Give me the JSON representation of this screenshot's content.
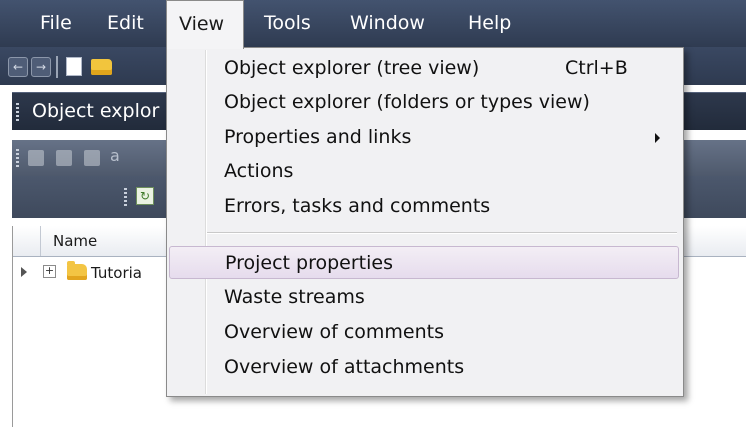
{
  "menubar": {
    "items": [
      {
        "label": "File"
      },
      {
        "label": "Edit"
      },
      {
        "label": "View"
      },
      {
        "label": "Tools"
      },
      {
        "label": "Window"
      },
      {
        "label": "Help"
      }
    ]
  },
  "panel": {
    "title": "Object explor",
    "toolbar_text": "a"
  },
  "grid": {
    "column_name": "Name",
    "rows": [
      {
        "label": "Tutoria"
      }
    ]
  },
  "view_menu": {
    "items": [
      {
        "label": "Object explorer (tree view)",
        "shortcut": "Ctrl+B"
      },
      {
        "label": "Object explorer (folders or types view)"
      },
      {
        "label": "Properties and links"
      },
      {
        "label": "Actions"
      },
      {
        "label": "Errors, tasks and comments"
      },
      {
        "label": "Project properties"
      },
      {
        "label": "Waste streams"
      },
      {
        "label": "Overview of comments"
      },
      {
        "label": "Overview of attachments"
      }
    ]
  },
  "colors": {
    "chrome_dark": "#2f3b51",
    "menu_background": "#f1f1f3",
    "menu_highlight": "#e6dced"
  }
}
